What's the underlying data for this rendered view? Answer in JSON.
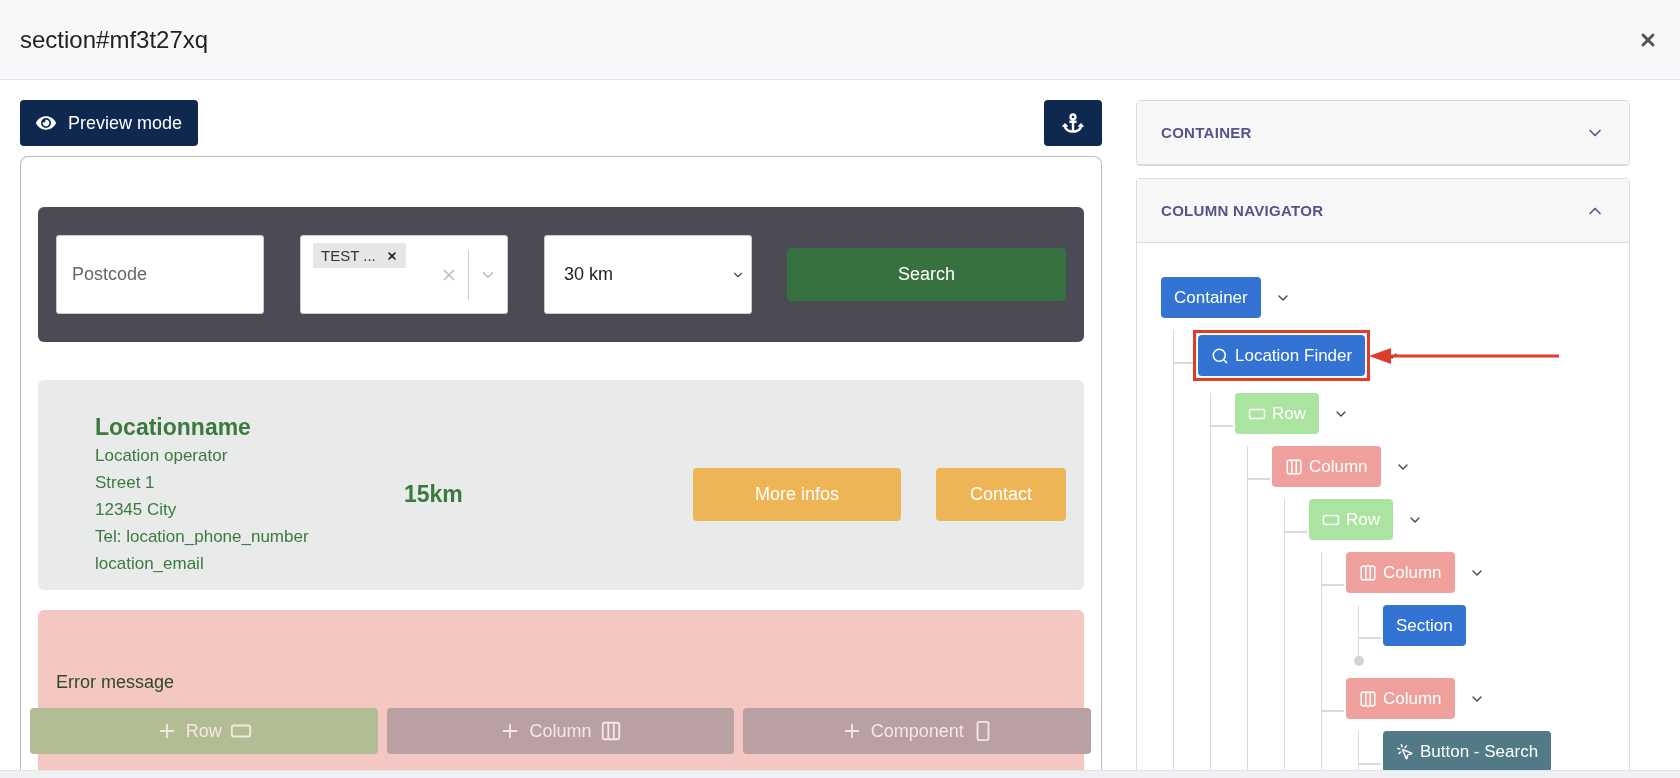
{
  "window": {
    "title": "section#mf3t27xq"
  },
  "toolbar": {
    "preview_button": "Preview mode"
  },
  "search_bar": {
    "postcode": {
      "placeholder": "Postcode"
    },
    "tags": [
      "TEST ..."
    ],
    "distance": "30 km",
    "search_button": "Search"
  },
  "location": {
    "name": "Locationname",
    "lines": [
      "Location operator",
      "Street 1",
      "12345 City",
      "Tel: location_phone_number",
      "location_email"
    ],
    "distance": "15km",
    "buttons": [
      "More infos",
      "Contact"
    ]
  },
  "error": {
    "message": "Error message"
  },
  "add_buttons": [
    {
      "label": "Row",
      "kind": "row"
    },
    {
      "label": "Column",
      "kind": "column"
    },
    {
      "label": "Component",
      "kind": "component"
    }
  ],
  "panel": {
    "sections": [
      {
        "title": "CONTAINER",
        "expanded": false
      },
      {
        "title": "COLUMN NAVIGATOR",
        "expanded": true
      }
    ],
    "tree": [
      {
        "label": "Container",
        "kind": "container",
        "expanded": true,
        "children": [
          {
            "label": "Location Finder",
            "kind": "finder",
            "highlighted": true,
            "expanded": true,
            "children": [
              {
                "label": "Row",
                "kind": "row",
                "expanded": true,
                "children": [
                  {
                    "label": "Column",
                    "kind": "column",
                    "expanded": true,
                    "children": [
                      {
                        "label": "Row",
                        "kind": "row",
                        "expanded": true,
                        "children": [
                          {
                            "label": "Column",
                            "kind": "column",
                            "expanded": true,
                            "children": [
                              {
                                "label": "Section",
                                "kind": "section"
                              },
                              {
                                "kind": "drop-point"
                              }
                            ]
                          },
                          {
                            "label": "Column",
                            "kind": "column",
                            "expanded": true,
                            "children": [
                              {
                                "label": "Button - Search",
                                "kind": "button"
                              }
                            ]
                          }
                        ]
                      }
                    ]
                  }
                ]
              }
            ]
          }
        ]
      }
    ]
  }
}
